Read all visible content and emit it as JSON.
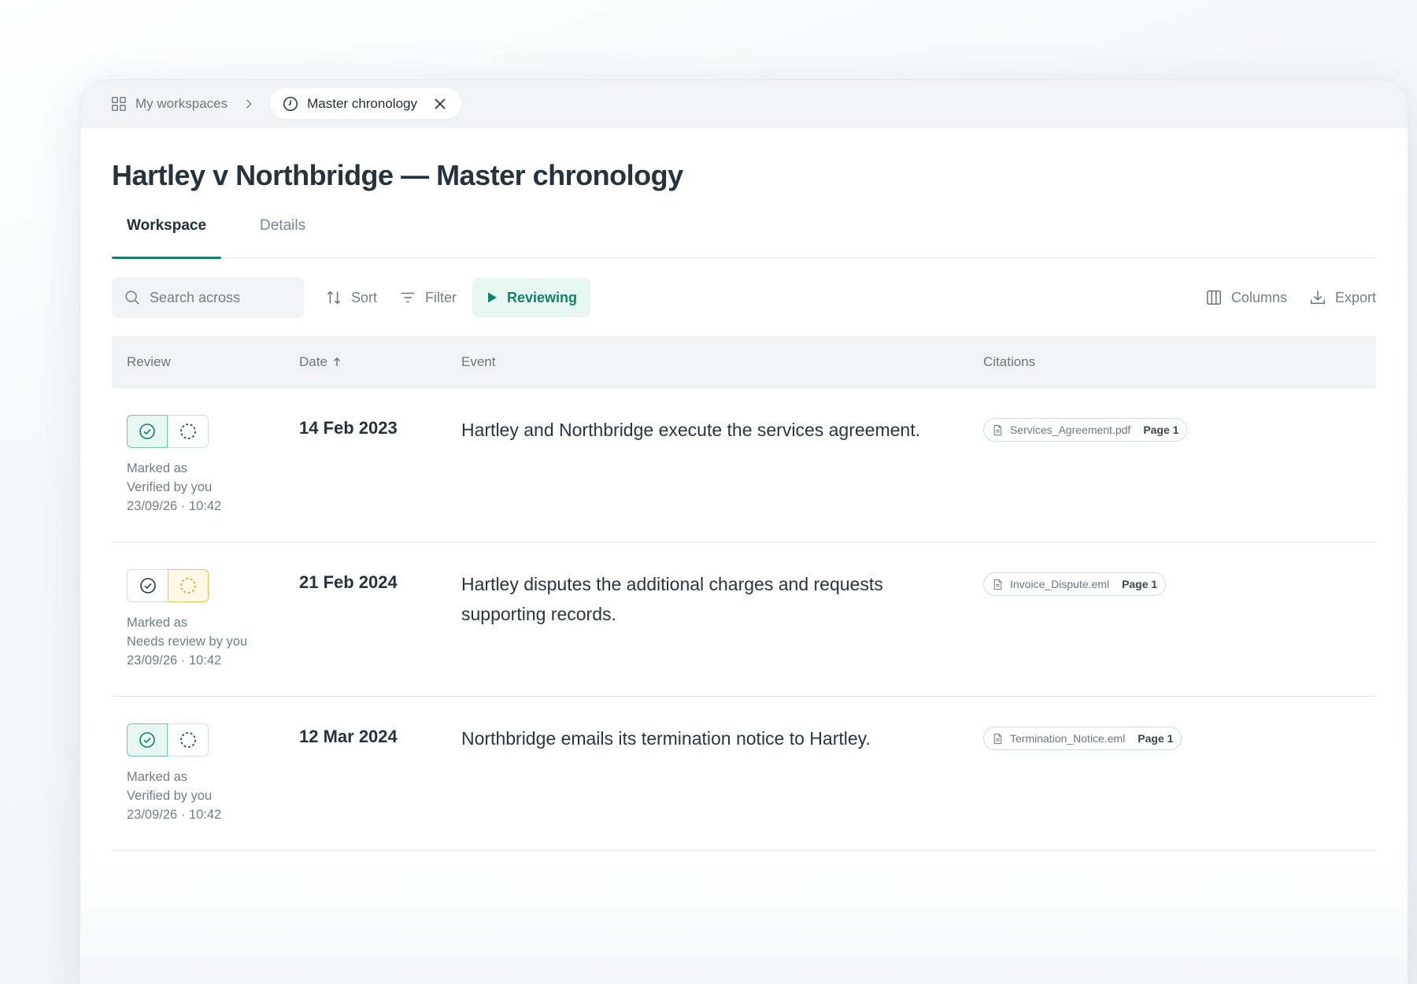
{
  "breadcrumb": {
    "home_label": "My workspaces",
    "current_tab_label": "Master chronology"
  },
  "page": {
    "title": "Hartley v Northbridge — Master chronology"
  },
  "tabs": [
    {
      "label": "Workspace",
      "active": true
    },
    {
      "label": "Details",
      "active": false
    }
  ],
  "toolbar": {
    "search_placeholder": "Search across",
    "sort_label": "Sort",
    "filter_label": "Filter",
    "reviewing_label": "Reviewing",
    "columns_label": "Columns",
    "export_label": "Export"
  },
  "table": {
    "headers": {
      "review": "Review",
      "date": "Date",
      "event": "Event",
      "citations": "Citations"
    },
    "rows": [
      {
        "status": "verified",
        "meta_line1": "Marked as",
        "meta_line2": "Verified by you",
        "meta_line3": "23/09/26 · 10:42",
        "date": "14 Feb 2023",
        "event": "Hartley and Northbridge execute the services agreement.",
        "citation_file": "Services_Agreement.pdf",
        "citation_page": "Page 1"
      },
      {
        "status": "needs-review",
        "meta_line1": "Marked as",
        "meta_line2": "Needs review by you",
        "meta_line3": "23/09/26 · 10:42",
        "date": "21 Feb 2024",
        "event": "Hartley disputes the additional charges and requests supporting records.",
        "citation_file": "Invoice_Dispute.eml",
        "citation_page": "Page 1"
      },
      {
        "status": "verified",
        "meta_line1": "Marked as",
        "meta_line2": "Verified by you",
        "meta_line3": "23/09/26 · 10:42",
        "date": "12 Mar 2024",
        "event": "Northbridge emails its termination notice to Hartley.",
        "citation_file": "Termination_Notice.eml",
        "citation_page": "Page 1"
      }
    ]
  },
  "colors": {
    "accent": "#16806b",
    "verified_bg": "#e7f7f1",
    "needs_review": "#f2c24f"
  }
}
